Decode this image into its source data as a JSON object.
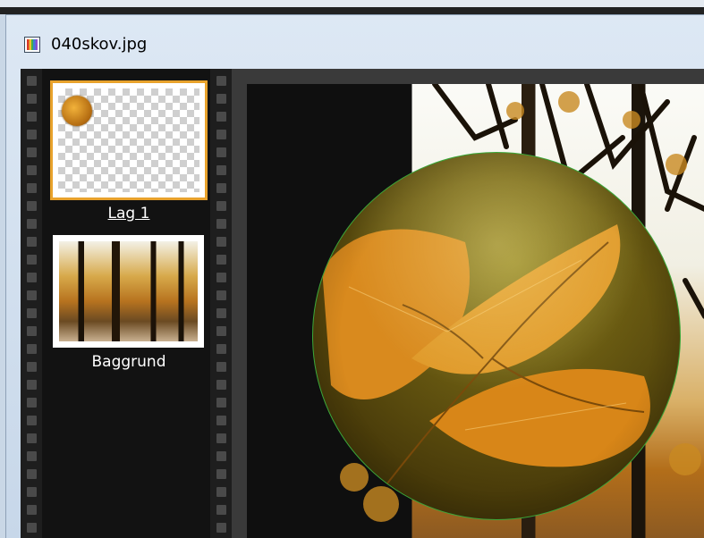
{
  "window": {
    "title": "040skov.jpg",
    "icon": "image-file-icon"
  },
  "layers": [
    {
      "label": "Lag 1",
      "selected": true,
      "thumbnail": "transparent-with-sphere"
    },
    {
      "label": "Baggrund",
      "selected": false,
      "thumbnail": "forest-photo"
    }
  ],
  "colors": {
    "selection_border": "#e8a22c",
    "sphere_outline": "#3aa83a",
    "filmstrip_bg": "#121212"
  }
}
